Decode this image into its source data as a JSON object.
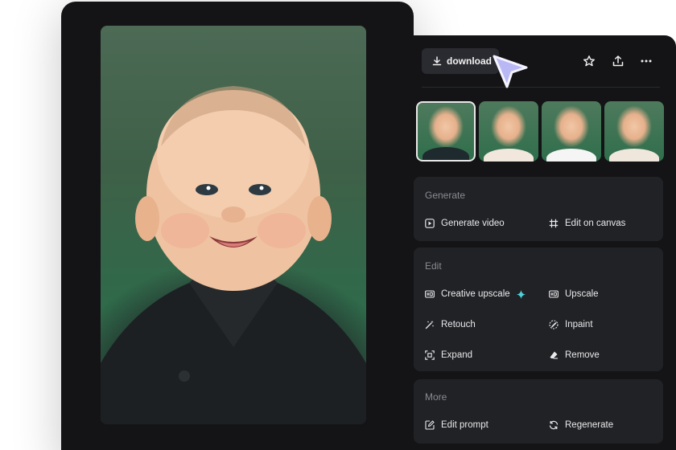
{
  "toolbar": {
    "download_label": "download",
    "icons": [
      "download-icon",
      "star-icon",
      "share-icon",
      "more-icon"
    ]
  },
  "thumbnails": [
    {
      "selected": true,
      "shirt": "#1f2a2e"
    },
    {
      "selected": false,
      "shirt": "#f1e7dd"
    },
    {
      "selected": false,
      "shirt": "#f5f5f5"
    },
    {
      "selected": false,
      "shirt": "#efe6dc"
    }
  ],
  "sections": {
    "generate": {
      "title": "Generate",
      "actions": [
        "Generate video",
        "Edit on canvas"
      ]
    },
    "edit": {
      "title": "Edit",
      "actions": [
        "Creative upscale",
        "Upscale",
        "Retouch",
        "Inpaint",
        "Expand",
        "Remove"
      ]
    },
    "more": {
      "title": "More",
      "actions": [
        "Edit prompt",
        "Regenerate"
      ]
    }
  },
  "colors": {
    "panel_bg": "#141416",
    "section_bg": "#212226",
    "accent_sparkle": "#4fd1d9",
    "cursor": "#b9b8f5"
  }
}
